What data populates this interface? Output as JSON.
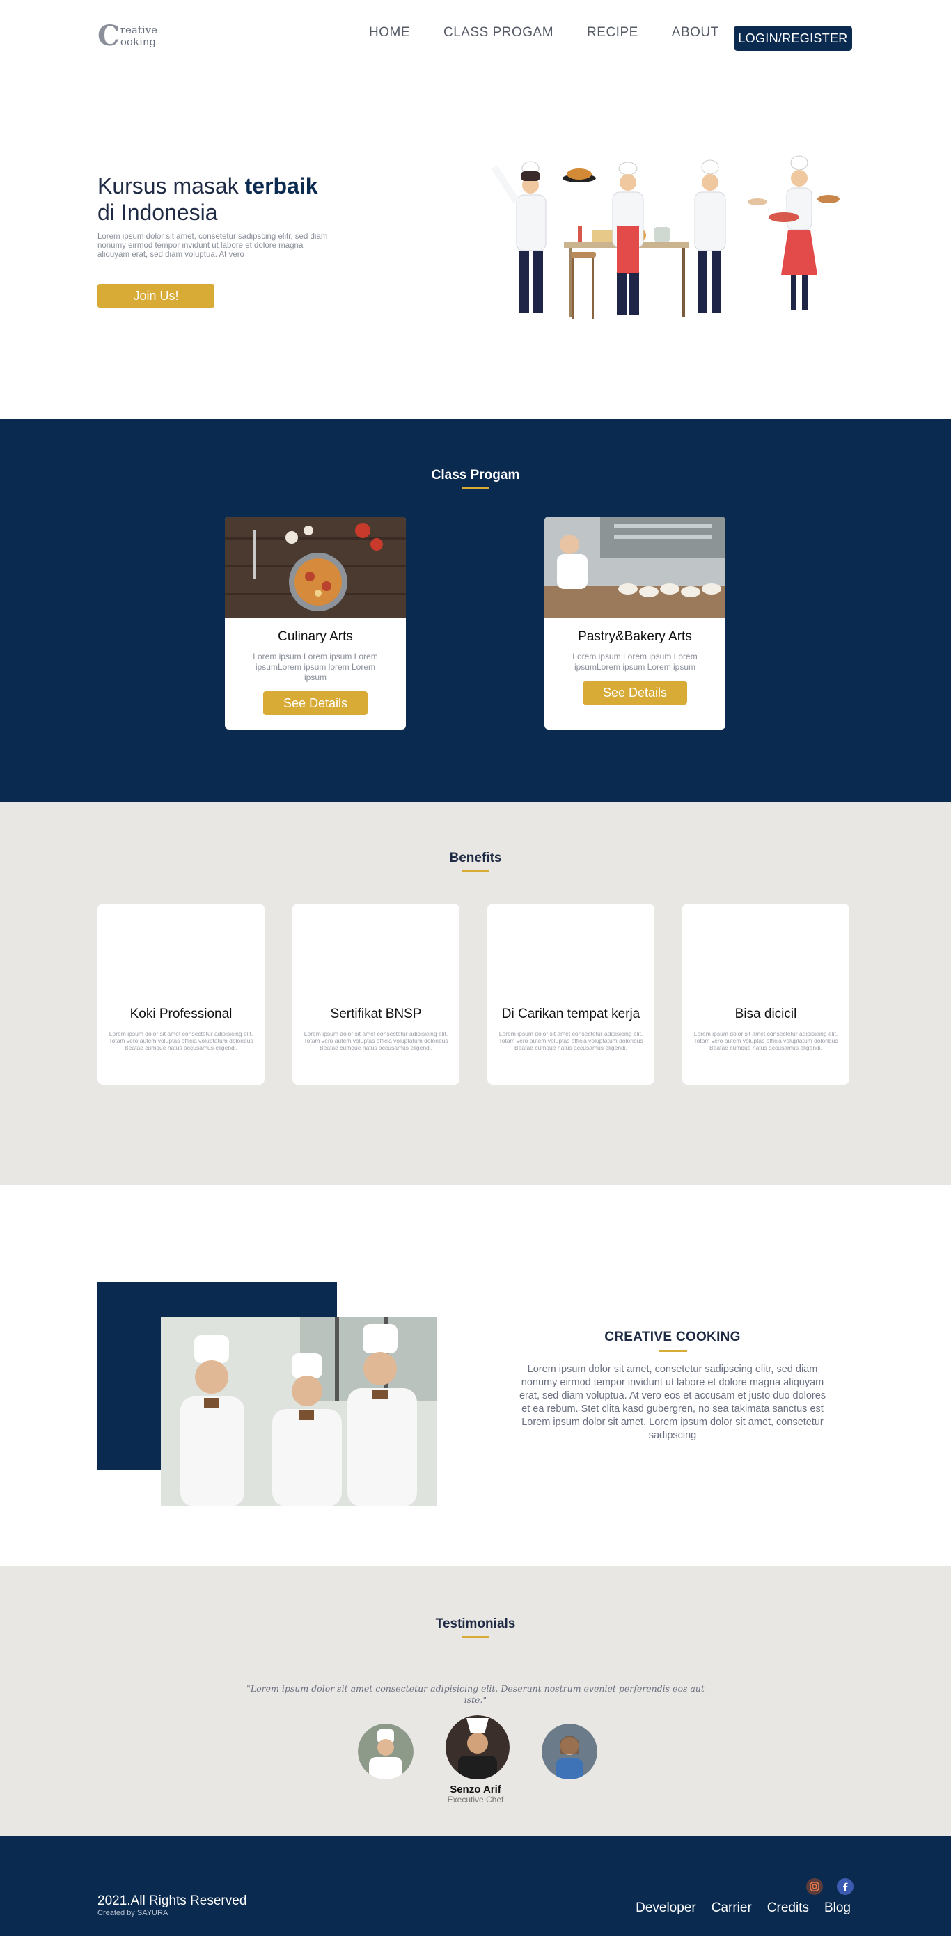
{
  "nav": {
    "logo_initial": "C",
    "logo_line1": "reative",
    "logo_line2": "ooking",
    "items": [
      "HOME",
      "CLASS PROGAM",
      "RECIPE",
      "ABOUT"
    ],
    "login_label": "LOGIN/REGISTER"
  },
  "hero": {
    "title_prefix": "Kursus masak ",
    "title_bold": "terbaik",
    "title_line2": "di Indonesia",
    "description": "Lorem ipsum dolor sit amet, consetetur sadipscing elitr, sed diam nonumy eirmod tempor invidunt ut labore et dolore magna aliquyam erat, sed diam voluptua. At vero",
    "cta_label": "Join Us!"
  },
  "classes": {
    "title": "Class Progam",
    "items": [
      {
        "title": "Culinary Arts",
        "description": "Lorem ipsum Lorem ipsum Lorem ipsumLorem ipsum lorem Lorem ipsum",
        "button": "See Details"
      },
      {
        "title": "Pastry&Bakery Arts",
        "description": "Lorem ipsum Lorem ipsum Lorem ipsumLorem ipsum Lorem ipsum",
        "button": "See Details"
      }
    ]
  },
  "benefits": {
    "title": "Benefits",
    "items": [
      {
        "title": "Koki Professional",
        "description": "Lorem ipsum dolor sit amet consectetur adipisicing elit. Totam vero autem voluptas officia voluptatum doloribus Beatae cumque natus accusamus eligendi."
      },
      {
        "title": "Sertifikat BNSP",
        "description": "Lorem ipsum dolor sit amet consectetur adipisicing elit. Totam vero autem voluptas officia voluptatum doloribus Beatae cumque natus accusamus eligendi."
      },
      {
        "title": "Di Carikan tempat kerja",
        "description": "Lorem ipsum dolor sit amet consectetur adipisicing elit. Totam vero autem voluptas officia voluptatum doloribus Beatae cumque natus accusamus eligendi."
      },
      {
        "title": "Bisa dicicil",
        "description": "Lorem ipsum dolor sit amet consectetur adipisicing elit. Totam vero autem voluptas officia voluptatum doloribus Beatae cumque natus accusamus eligendi."
      }
    ]
  },
  "about": {
    "title": "CREATIVE COOKING",
    "text": "Lorem ipsum dolor sit amet, consetetur sadipscing elitr, sed diam nonumy eirmod tempor invidunt ut labore et dolore magna aliquyam erat, sed diam voluptua. At vero eos et accusam et justo duo dolores et ea rebum. Stet clita kasd gubergren, no sea takimata sanctus est Lorem ipsum dolor sit amet. Lorem ipsum dolor sit amet, consetetur sadipscing"
  },
  "testimonials": {
    "title": "Testimonials",
    "quote": "\"Lorem ipsum dolor sit amet consectetur adipisicing elit. Deserunt nostrum eveniet perferendis eos aut iste.\"",
    "name": "Senzo Arif",
    "role": "Executive Chef"
  },
  "footer": {
    "copyright": "2021.All Rights Reserved",
    "created_by": "Created by SAYURA",
    "links": [
      "Developer",
      "Carrier",
      "Credits",
      "Blog"
    ],
    "social_icons": [
      "instagram-icon",
      "facebook-icon"
    ]
  },
  "colors": {
    "navy": "#0b2a4f",
    "gold": "#d8ab36",
    "light_gray": "#e9e7e3"
  }
}
